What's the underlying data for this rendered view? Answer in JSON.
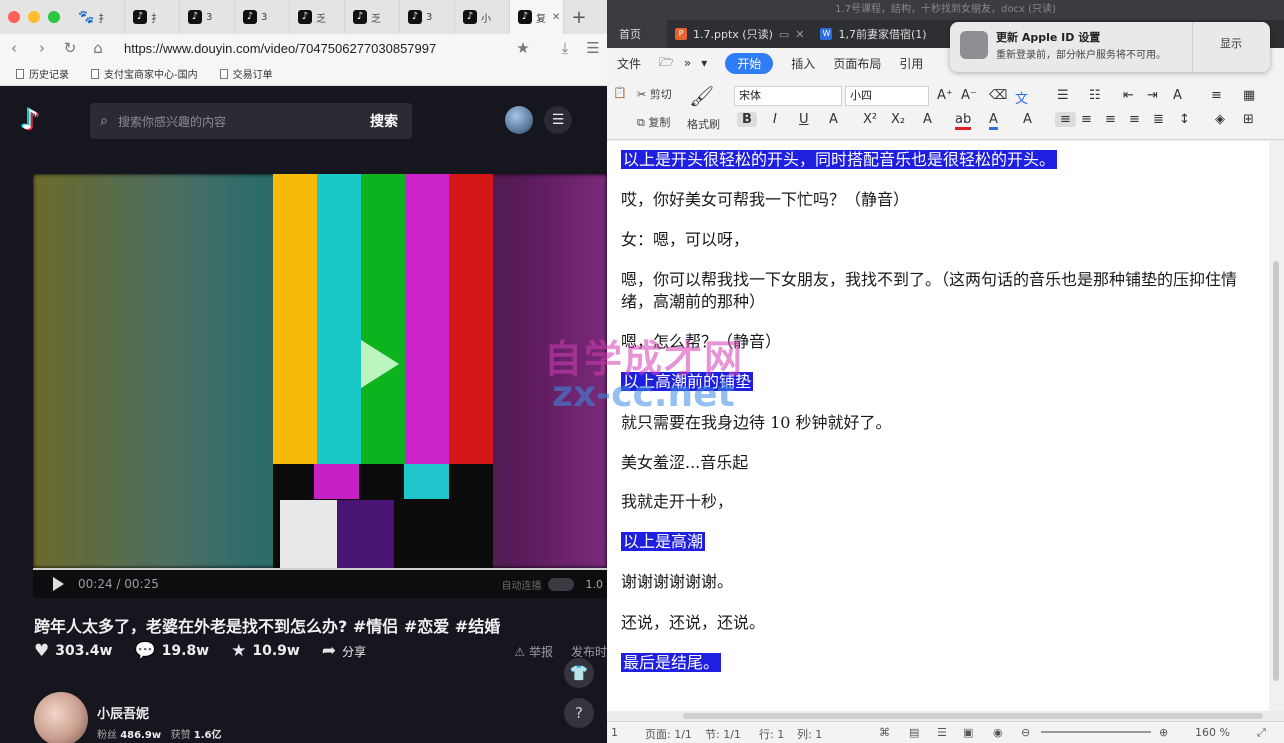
{
  "browser": {
    "traffic_colors": [
      "#ff5f57",
      "#febc2e",
      "#28c840"
    ],
    "tabs": [
      {
        "label": "扌",
        "icon": "baidu-paw-icon"
      },
      {
        "label": "扌",
        "icon": "douyin-icon"
      },
      {
        "label": "3",
        "icon": "douyin-icon"
      },
      {
        "label": "3",
        "icon": "douyin-icon"
      },
      {
        "label": "乏",
        "icon": "douyin-icon"
      },
      {
        "label": "乏",
        "icon": "douyin-icon"
      },
      {
        "label": "3",
        "icon": "douyin-icon"
      },
      {
        "label": "小",
        "icon": "douyin-icon"
      },
      {
        "label": "复",
        "icon": "douyin-icon",
        "active": true
      }
    ],
    "close_glyph": "✕",
    "newtab_glyph": "+",
    "url": "https://www.douyin.com/video/7047506277030857997",
    "bookmarks": [
      "历史记录",
      "支付宝商家中心-国内",
      "交易订单"
    ]
  },
  "douyin": {
    "search_placeholder": "搜索你感兴趣的内容",
    "search_button": "搜索",
    "video": {
      "bar_colors": [
        "#f9b909",
        "#1ac8c8",
        "#0db21f",
        "#cb24cb",
        "#d41616"
      ],
      "time_current": "00:24",
      "time_total": "00:25",
      "auto_next": "自动连播",
      "speed": "1.0"
    },
    "title": "跨年人太多了，老婆在外老是找不到怎么办? #情侣 #恋爱 #结婚",
    "stats": {
      "likes": "303.4w",
      "comments": "19.8w",
      "favorites": "10.9w",
      "share": "分享",
      "report": "举报",
      "publish": "发布时"
    },
    "author": {
      "name": "小辰吾妮",
      "fans_label": "粉丝",
      "fans": "486.9w",
      "likes_label": "获赞",
      "likes": "1.6亿"
    }
  },
  "wps": {
    "window_title": "1.7号课程，结构，十秒找到女朋友，docx (只读)",
    "tabs": [
      {
        "label": "首页"
      },
      {
        "label": "1.7.pptx (只读)",
        "color": "#e8632b"
      },
      {
        "label": "1,7前妻家借宿(1)",
        "color": "#2f6de0"
      }
    ],
    "menu": [
      "文件",
      "开始",
      "插入",
      "页面布局",
      "引用"
    ],
    "notification": {
      "title": "更新 Apple ID 设置",
      "body": "重新登录前，部分帐户服务将不可用。",
      "action": "显示"
    },
    "ribbon": {
      "cut": "剪切",
      "copy": "复制",
      "format_painter": "格式刷",
      "font": "宋体",
      "size": "小四"
    },
    "highlight_color": "#1f1fe0",
    "paragraphs": [
      {
        "text": "以上是开头很轻松的开头，同时搭配音乐也是很轻松的开头。",
        "highlight": true
      },
      {
        "text": "哎，你好美女可帮我一下忙吗？（静音）",
        "highlight": false
      },
      {
        "text": "女：嗯，可以呀，",
        "highlight": false
      },
      {
        "text": "嗯，你可以帮我找一下女朋友，我找不到了。（这两句话的音乐也是那种铺垫的压抑住情绪，高潮前的那种）",
        "highlight": false
      },
      {
        "text": "嗯，怎么帮？（静音）",
        "highlight": false
      },
      {
        "text": "以上高潮前的铺垫",
        "highlight": true
      },
      {
        "text": "就只需要在我身边待 10 秒钟就好了。",
        "highlight": false
      },
      {
        "text": "美女羞涩...音乐起",
        "highlight": false
      },
      {
        "text": "我就走开十秒，",
        "highlight": false
      },
      {
        "text": "以上是高潮",
        "highlight": true
      },
      {
        "text": "谢谢谢谢谢谢。",
        "highlight": false
      },
      {
        "text": "还说，还说，还说。",
        "highlight": false
      },
      {
        "text": "最后是结尾。",
        "highlight": true
      }
    ],
    "status": {
      "page_num": "1",
      "pages": "页面: 1/1",
      "section": "节: 1/1",
      "line": "行: 1",
      "column": "列: 1",
      "zoom": "160 %"
    }
  },
  "watermark": {
    "line1": "自学成才网",
    "line2": "zx-cc.net"
  }
}
